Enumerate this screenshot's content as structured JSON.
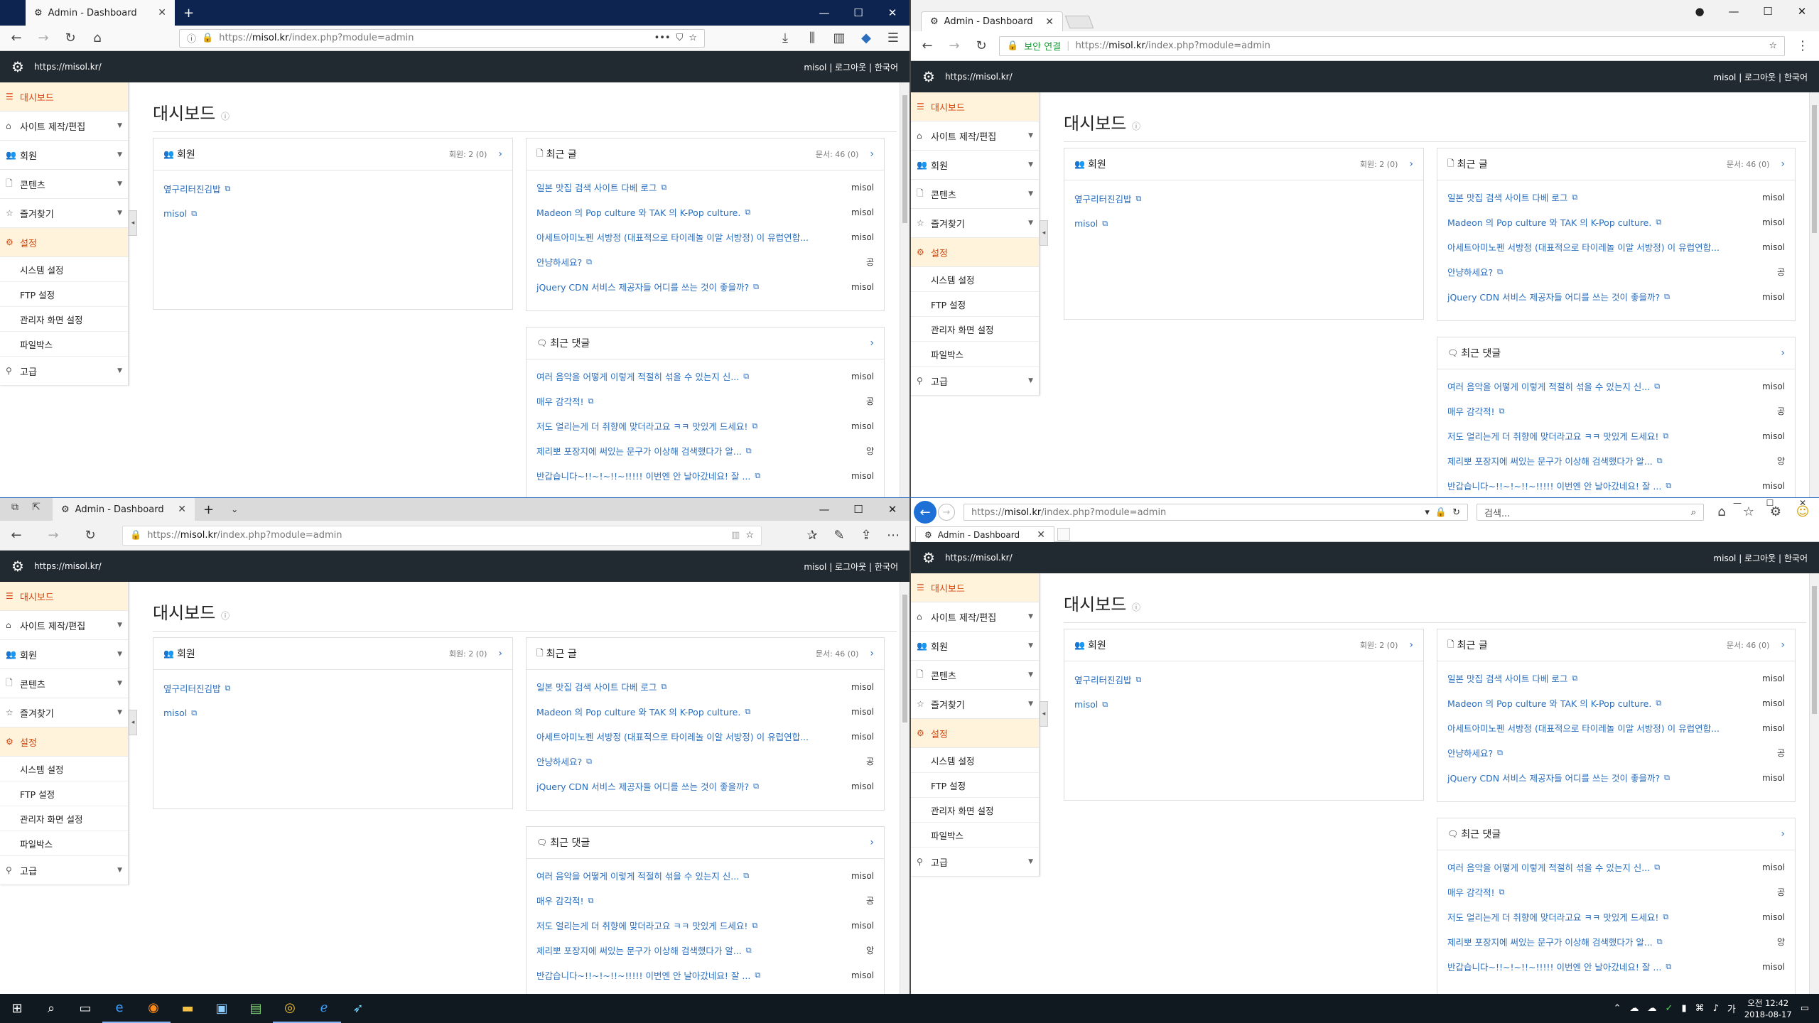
{
  "windows": [
    {
      "id": "firefox",
      "tab_title": "Admin - Dashboard",
      "url_prefix": "https://",
      "url_host": "misol.kr",
      "url_path": "/index.php?module=admin",
      "badge": ""
    },
    {
      "id": "chrome",
      "tab_title": "Admin - Dashboard",
      "url_prefix": "https://",
      "url_host": "misol.kr",
      "url_path": "/index.php?module=admin",
      "badge": "보안 연결"
    },
    {
      "id": "edge",
      "tab_title": "Admin - Dashboard",
      "url_prefix": "https://",
      "url_host": "misol.kr",
      "url_path": "/index.php?module=admin",
      "badge": ""
    },
    {
      "id": "ie",
      "tab_title": "Admin - Dashboard",
      "url_prefix": "https://",
      "url_host": "misol.kr",
      "url_path": "/index.php?module=admin",
      "badge": "",
      "search_placeholder": "검색..."
    }
  ],
  "app": {
    "site": "https://misol.kr/",
    "user_links": "misol | 로그아웃 | 한국어",
    "page_title": "대시보드",
    "sidebar": {
      "dashboard": "대시보드",
      "site_design": "사이트 제작/편집",
      "members": "회원",
      "contents": "콘텐츠",
      "favorites": "즐겨찾기",
      "settings": "설정",
      "sub": [
        "시스템 설정",
        "FTP 설정",
        "관리자 화면 설정",
        "파일박스"
      ],
      "advanced": "고급"
    },
    "members_panel": {
      "title": "회원",
      "meta": "회원: 2 (0)",
      "rows": [
        "옆구리터진김밥",
        "misol"
      ]
    },
    "posts_panel": {
      "title": "최근 글",
      "meta": "문서: 46 (0)",
      "rows": [
        {
          "title": "일본 맛집 검색 사이트 다베 로그",
          "author": "misol"
        },
        {
          "title": "Madeon 의 Pop culture 와 TAK 의 K-Pop culture.",
          "author": "misol"
        },
        {
          "title": "아세트아미노펜 서방정 (대표적으로 타이레놀 이알 서방정) 이 유럽연합...",
          "author": "misol"
        },
        {
          "title": "안냥하세요?",
          "author": "공"
        },
        {
          "title": "jQuery CDN 서비스 제공자들 어디를 쓰는 것이 좋을까?",
          "author": "misol"
        }
      ]
    },
    "comments_panel": {
      "title": "최근 댓글",
      "rows": [
        {
          "title": "여러 음악을 어떻게 이렇게 적절히 섞을 수 있는지 신...",
          "author": "misol"
        },
        {
          "title": "매우 감각적!",
          "author": "공"
        },
        {
          "title": "저도 얼리는게 더 취향에 맞더라고요 ㅋㅋ 맛있게 드세요!",
          "author": "misol"
        },
        {
          "title": "제리뽀 포장지에 써있는 문구가 이상해 검색했다가 알...",
          "author": "앙"
        },
        {
          "title": "반갑습니다~!!~!~!!~!!!!! 이번엔 안 날아갔네요! 잘 ...",
          "author": "misol"
        }
      ]
    }
  },
  "taskbar": {
    "time": "오전 12:42",
    "date": "2018-08-17"
  }
}
